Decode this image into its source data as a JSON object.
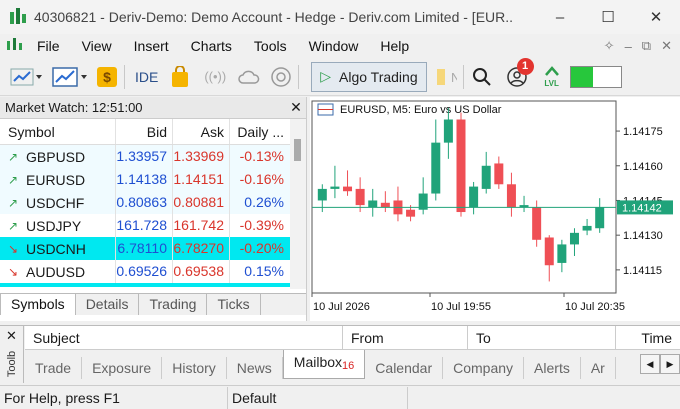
{
  "window": {
    "title": "40306821 - Deriv-Demo: Demo Account - Hedge - Deriv.com Limited - [EUR...",
    "controls": [
      "–",
      "☐",
      "✕"
    ]
  },
  "menu": [
    "File",
    "View",
    "Insert",
    "Charts",
    "Tools",
    "Window",
    "Help"
  ],
  "toolbar": {
    "ide_label": "IDE",
    "algo_label": "Algo Trading",
    "notif_count": "1",
    "level_label": "LVL",
    "level_fraction": 0.45,
    "colors": {
      "accent": "#2e9e4c",
      "badge": "#e3342f",
      "level": "#27c73c"
    }
  },
  "market_watch": {
    "title": "Market Watch: 12:51:00",
    "headers": {
      "symbol": "Symbol",
      "bid": "Bid",
      "ask": "Ask",
      "daily": "Daily ..."
    },
    "rows": [
      {
        "symbol": "GBPUSD",
        "bid": "1.33957",
        "ask": "1.33969",
        "daily": "-0.13%",
        "dir": "up",
        "bg": "#f0fbff"
      },
      {
        "symbol": "EURUSD",
        "bid": "1.14138",
        "ask": "1.14151",
        "daily": "-0.16%",
        "dir": "up",
        "bg": "#f0fbff"
      },
      {
        "symbol": "USDCHF",
        "bid": "0.80863",
        "ask": "0.80881",
        "daily": "0.26%",
        "dir": "up",
        "bg": "#f0fbff"
      },
      {
        "symbol": "USDJPY",
        "bid": "161.728",
        "ask": "161.742",
        "daily": "-0.39%",
        "dir": "up",
        "bg": "#ffffff"
      },
      {
        "symbol": "USDCNH",
        "bid": "6.78110",
        "ask": "6.78270",
        "daily": "-0.20%",
        "dir": "down",
        "bg": "#00e8f0"
      },
      {
        "symbol": "AUDUSD",
        "bid": "0.69526",
        "ask": "0.69538",
        "daily": "0.15%",
        "dir": "down",
        "bg": "#ffffff"
      }
    ],
    "tabs": [
      "Symbols",
      "Details",
      "Trading",
      "Ticks"
    ],
    "active_tab": "Symbols"
  },
  "chart_data": {
    "type": "candlestick",
    "title": "EURUSD, M5:  Euro vs US Dollar",
    "x_ticks": [
      "10 Jul 2026",
      "10 Jul 19:55",
      "10 Jul 20:35"
    ],
    "y_ticks": [
      "1.14175",
      "1.14160",
      "1.14145",
      "1.14130",
      "1.14115"
    ],
    "current_price": "1.14142",
    "ylim": [
      1.14105,
      1.14188
    ],
    "colors": {
      "up": "#20a37a",
      "down": "#ef4f55",
      "price_line": "#20a37a",
      "price_box": "#20a37a"
    },
    "candles": [
      {
        "o": 1.14145,
        "h": 1.14152,
        "l": 1.1414,
        "c": 1.1415
      },
      {
        "o": 1.1415,
        "h": 1.1416,
        "l": 1.14146,
        "c": 1.14151
      },
      {
        "o": 1.14151,
        "h": 1.14158,
        "l": 1.14147,
        "c": 1.14149
      },
      {
        "o": 1.1415,
        "h": 1.14155,
        "l": 1.1414,
        "c": 1.14143
      },
      {
        "o": 1.14142,
        "h": 1.1415,
        "l": 1.14138,
        "c": 1.14145
      },
      {
        "o": 1.14144,
        "h": 1.14149,
        "l": 1.1414,
        "c": 1.14142
      },
      {
        "o": 1.14145,
        "h": 1.14151,
        "l": 1.14136,
        "c": 1.14139
      },
      {
        "o": 1.14141,
        "h": 1.14143,
        "l": 1.14136,
        "c": 1.14138
      },
      {
        "o": 1.14141,
        "h": 1.14155,
        "l": 1.14139,
        "c": 1.14148
      },
      {
        "o": 1.14148,
        "h": 1.1418,
        "l": 1.14145,
        "c": 1.1417
      },
      {
        "o": 1.1417,
        "h": 1.14185,
        "l": 1.14163,
        "c": 1.1418
      },
      {
        "o": 1.1418,
        "h": 1.14183,
        "l": 1.14138,
        "c": 1.1414
      },
      {
        "o": 1.14142,
        "h": 1.14153,
        "l": 1.14139,
        "c": 1.14151
      },
      {
        "o": 1.1415,
        "h": 1.14166,
        "l": 1.14148,
        "c": 1.1416
      },
      {
        "o": 1.14161,
        "h": 1.14164,
        "l": 1.1415,
        "c": 1.14152
      },
      {
        "o": 1.14152,
        "h": 1.14157,
        "l": 1.14138,
        "c": 1.14142
      },
      {
        "o": 1.14142,
        "h": 1.14147,
        "l": 1.1414,
        "c": 1.14143
      },
      {
        "o": 1.14142,
        "h": 1.14145,
        "l": 1.14125,
        "c": 1.14128
      },
      {
        "o": 1.14129,
        "h": 1.1413,
        "l": 1.1411,
        "c": 1.14117
      },
      {
        "o": 1.14118,
        "h": 1.14128,
        "l": 1.14114,
        "c": 1.14126
      },
      {
        "o": 1.14126,
        "h": 1.14133,
        "l": 1.14121,
        "c": 1.14131
      },
      {
        "o": 1.14132,
        "h": 1.14137,
        "l": 1.1413,
        "c": 1.14134
      },
      {
        "o": 1.14133,
        "h": 1.14146,
        "l": 1.14131,
        "c": 1.14142
      }
    ]
  },
  "toolbox": {
    "side_label": "Toolb",
    "columns": [
      "Subject",
      "From",
      "To",
      "Time"
    ],
    "tabs": [
      {
        "label": "Trade",
        "count": ""
      },
      {
        "label": "Exposure",
        "count": ""
      },
      {
        "label": "History",
        "count": ""
      },
      {
        "label": "News",
        "count": ""
      },
      {
        "label": "Mailbox",
        "count": "16"
      },
      {
        "label": "Calendar",
        "count": ""
      },
      {
        "label": "Company",
        "count": ""
      },
      {
        "label": "Alerts",
        "count": ""
      },
      {
        "label": "Ar",
        "count": ""
      }
    ],
    "active_tab": "Mailbox"
  },
  "status": {
    "help": "For Help, press F1",
    "profile": "Default"
  }
}
